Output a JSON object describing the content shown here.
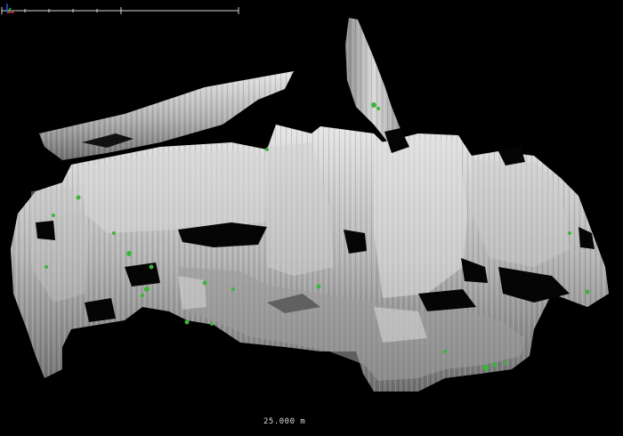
{
  "viewer": {
    "background_color": "#000000",
    "point_cloud_color": "#c8c8c8",
    "vegetation_color": "#3cb43c"
  },
  "scale_bar": {
    "label": "25.000 m",
    "color": "#d8d8d8"
  },
  "axis_gizmo": {
    "x_color": "#d03030",
    "y_color": "#30c030",
    "z_color": "#3050e0"
  }
}
